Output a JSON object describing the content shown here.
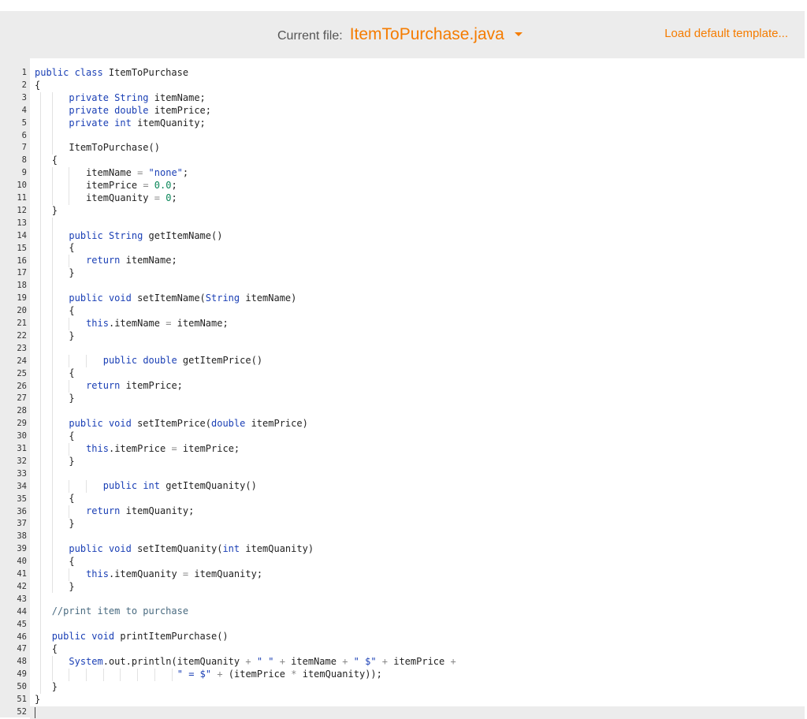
{
  "header": {
    "current_file_label": "Current file:",
    "file_name": "ItemToPurchase.java",
    "load_default": "Load default template..."
  },
  "editor": {
    "lines": [
      {
        "indent": 0,
        "guides": [],
        "tokens": [
          [
            "k",
            "public class "
          ],
          [
            "",
            "ItemToPurchase"
          ]
        ]
      },
      {
        "indent": 0,
        "guides": [],
        "tokens": [
          [
            "",
            "{"
          ]
        ]
      },
      {
        "indent": 6,
        "guides": [
          1,
          3
        ],
        "tokens": [
          [
            "k",
            "private String "
          ],
          [
            "",
            "itemName;"
          ]
        ]
      },
      {
        "indent": 6,
        "guides": [
          1,
          3
        ],
        "tokens": [
          [
            "k",
            "private double "
          ],
          [
            "",
            "itemPrice;"
          ]
        ]
      },
      {
        "indent": 6,
        "guides": [
          1,
          3
        ],
        "tokens": [
          [
            "k",
            "private int "
          ],
          [
            "",
            "itemQuanity;"
          ]
        ]
      },
      {
        "indent": 0,
        "guides": [
          1,
          3
        ],
        "tokens": []
      },
      {
        "indent": 6,
        "guides": [
          1,
          3
        ],
        "tokens": [
          [
            "",
            "ItemToPurchase()"
          ]
        ]
      },
      {
        "indent": 3,
        "guides": [
          1
        ],
        "tokens": [
          [
            "",
            "{"
          ]
        ]
      },
      {
        "indent": 9,
        "guides": [
          1,
          3,
          6
        ],
        "tokens": [
          [
            "",
            "itemName "
          ],
          [
            "o",
            "= "
          ],
          [
            "s",
            "\"none\""
          ],
          [
            "",
            ";"
          ]
        ]
      },
      {
        "indent": 9,
        "guides": [
          1,
          3,
          6
        ],
        "tokens": [
          [
            "",
            "itemPrice "
          ],
          [
            "o",
            "= "
          ],
          [
            "n",
            "0.0"
          ],
          [
            "",
            ";"
          ]
        ]
      },
      {
        "indent": 9,
        "guides": [
          1,
          3,
          6
        ],
        "tokens": [
          [
            "",
            "itemQuanity "
          ],
          [
            "o",
            "= "
          ],
          [
            "n",
            "0"
          ],
          [
            "",
            ";"
          ]
        ]
      },
      {
        "indent": 3,
        "guides": [
          1
        ],
        "tokens": [
          [
            "",
            "}"
          ]
        ]
      },
      {
        "indent": 0,
        "guides": [
          1,
          3
        ],
        "tokens": []
      },
      {
        "indent": 6,
        "guides": [
          1,
          3
        ],
        "tokens": [
          [
            "k",
            "public String "
          ],
          [
            "",
            "getItemName()"
          ]
        ]
      },
      {
        "indent": 6,
        "guides": [
          1,
          3
        ],
        "tokens": [
          [
            "",
            "{"
          ]
        ]
      },
      {
        "indent": 9,
        "guides": [
          1,
          3,
          6
        ],
        "tokens": [
          [
            "k",
            "return "
          ],
          [
            "",
            "itemName;"
          ]
        ]
      },
      {
        "indent": 6,
        "guides": [
          1,
          3
        ],
        "tokens": [
          [
            "",
            "}"
          ]
        ]
      },
      {
        "indent": 0,
        "guides": [
          1,
          3
        ],
        "tokens": []
      },
      {
        "indent": 6,
        "guides": [
          1,
          3
        ],
        "tokens": [
          [
            "k",
            "public void "
          ],
          [
            "",
            "setItemName("
          ],
          [
            "k",
            "String "
          ],
          [
            "",
            "itemName)"
          ]
        ]
      },
      {
        "indent": 6,
        "guides": [
          1,
          3
        ],
        "tokens": [
          [
            "",
            "{"
          ]
        ]
      },
      {
        "indent": 9,
        "guides": [
          1,
          3,
          6
        ],
        "tokens": [
          [
            "k",
            "this"
          ],
          [
            "",
            ".itemName "
          ],
          [
            "o",
            "= "
          ],
          [
            "",
            "itemName;"
          ]
        ]
      },
      {
        "indent": 6,
        "guides": [
          1,
          3
        ],
        "tokens": [
          [
            "",
            "}"
          ]
        ]
      },
      {
        "indent": 0,
        "guides": [
          1,
          3
        ],
        "tokens": []
      },
      {
        "indent": 12,
        "guides": [
          1,
          3,
          6,
          9
        ],
        "tokens": [
          [
            "k",
            "public double "
          ],
          [
            "",
            "getItemPrice()"
          ]
        ]
      },
      {
        "indent": 6,
        "guides": [
          1,
          3
        ],
        "tokens": [
          [
            "",
            "{"
          ]
        ]
      },
      {
        "indent": 9,
        "guides": [
          1,
          3,
          6
        ],
        "tokens": [
          [
            "k",
            "return "
          ],
          [
            "",
            "itemPrice;"
          ]
        ]
      },
      {
        "indent": 6,
        "guides": [
          1,
          3
        ],
        "tokens": [
          [
            "",
            "}"
          ]
        ]
      },
      {
        "indent": 0,
        "guides": [
          1,
          3
        ],
        "tokens": []
      },
      {
        "indent": 6,
        "guides": [
          1,
          3
        ],
        "tokens": [
          [
            "k",
            "public void "
          ],
          [
            "",
            "setItemPrice("
          ],
          [
            "k",
            "double "
          ],
          [
            "",
            "itemPrice)"
          ]
        ]
      },
      {
        "indent": 6,
        "guides": [
          1,
          3
        ],
        "tokens": [
          [
            "",
            "{"
          ]
        ]
      },
      {
        "indent": 9,
        "guides": [
          1,
          3,
          6
        ],
        "tokens": [
          [
            "k",
            "this"
          ],
          [
            "",
            ".itemPrice "
          ],
          [
            "o",
            "= "
          ],
          [
            "",
            "itemPrice;"
          ]
        ]
      },
      {
        "indent": 6,
        "guides": [
          1,
          3
        ],
        "tokens": [
          [
            "",
            "}"
          ]
        ]
      },
      {
        "indent": 0,
        "guides": [
          1,
          3
        ],
        "tokens": []
      },
      {
        "indent": 12,
        "guides": [
          1,
          3,
          6,
          9
        ],
        "tokens": [
          [
            "k",
            "public int "
          ],
          [
            "",
            "getItemQuanity()"
          ]
        ]
      },
      {
        "indent": 6,
        "guides": [
          1,
          3
        ],
        "tokens": [
          [
            "",
            "{"
          ]
        ]
      },
      {
        "indent": 9,
        "guides": [
          1,
          3,
          6
        ],
        "tokens": [
          [
            "k",
            "return "
          ],
          [
            "",
            "itemQuanity;"
          ]
        ]
      },
      {
        "indent": 6,
        "guides": [
          1,
          3
        ],
        "tokens": [
          [
            "",
            "}"
          ]
        ]
      },
      {
        "indent": 0,
        "guides": [
          1,
          3
        ],
        "tokens": []
      },
      {
        "indent": 6,
        "guides": [
          1,
          3
        ],
        "tokens": [
          [
            "k",
            "public void "
          ],
          [
            "",
            "setItemQuanity("
          ],
          [
            "k",
            "int "
          ],
          [
            "",
            "itemQuanity)"
          ]
        ]
      },
      {
        "indent": 6,
        "guides": [
          1,
          3
        ],
        "tokens": [
          [
            "",
            "{"
          ]
        ]
      },
      {
        "indent": 9,
        "guides": [
          1,
          3,
          6
        ],
        "tokens": [
          [
            "k",
            "this"
          ],
          [
            "",
            ".itemQuanity "
          ],
          [
            "o",
            "= "
          ],
          [
            "",
            "itemQuanity;"
          ]
        ]
      },
      {
        "indent": 6,
        "guides": [
          1,
          3
        ],
        "tokens": [
          [
            "",
            "}"
          ]
        ]
      },
      {
        "indent": 0,
        "guides": [
          1
        ],
        "tokens": []
      },
      {
        "indent": 3,
        "guides": [
          1
        ],
        "tokens": [
          [
            "c",
            "//print item to purchase"
          ]
        ]
      },
      {
        "indent": 0,
        "guides": [
          1
        ],
        "tokens": []
      },
      {
        "indent": 3,
        "guides": [
          1
        ],
        "tokens": [
          [
            "k",
            "public void "
          ],
          [
            "",
            "printItemPurchase()"
          ]
        ]
      },
      {
        "indent": 3,
        "guides": [
          1
        ],
        "tokens": [
          [
            "",
            "{"
          ]
        ]
      },
      {
        "indent": 6,
        "guides": [
          1,
          3
        ],
        "tokens": [
          [
            "k",
            "System"
          ],
          [
            "",
            ".out.println(itemQuanity "
          ],
          [
            "o",
            "+ "
          ],
          [
            "s",
            "\" \" "
          ],
          [
            "o",
            "+ "
          ],
          [
            "",
            "itemName "
          ],
          [
            "o",
            "+ "
          ],
          [
            "s",
            "\" $\" "
          ],
          [
            "o",
            "+ "
          ],
          [
            "",
            "itemPrice "
          ],
          [
            "o",
            "+"
          ]
        ]
      },
      {
        "indent": 25,
        "guides": [
          1,
          3,
          6,
          9,
          12,
          15,
          18,
          21,
          24
        ],
        "tokens": [
          [
            "s",
            "\" = $\" "
          ],
          [
            "o",
            "+ "
          ],
          [
            "",
            "(itemPrice "
          ],
          [
            "o",
            "* "
          ],
          [
            "",
            "itemQuanity));"
          ]
        ]
      },
      {
        "indent": 3,
        "guides": [
          1
        ],
        "tokens": [
          [
            "",
            "}"
          ]
        ]
      },
      {
        "indent": 0,
        "guides": [],
        "tokens": [
          [
            "",
            "}"
          ]
        ]
      },
      {
        "indent": 0,
        "guides": [],
        "tokens": []
      }
    ]
  }
}
